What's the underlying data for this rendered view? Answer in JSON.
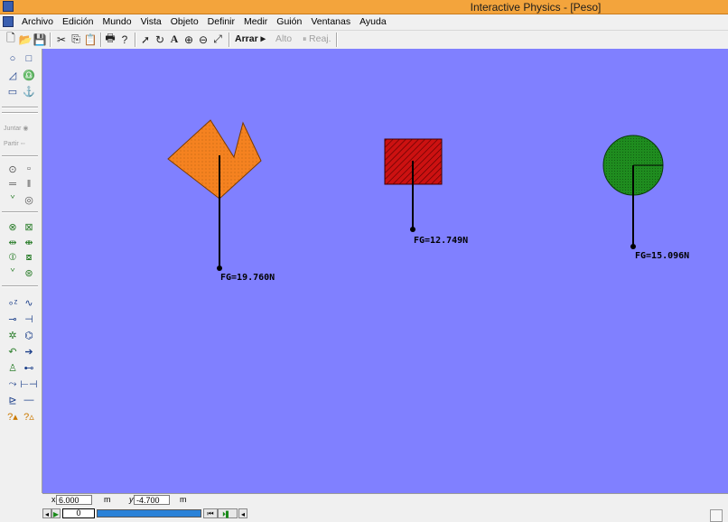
{
  "window": {
    "title": "Interactive Physics - [Peso]"
  },
  "menu": [
    "Archivo",
    "Edición",
    "Mundo",
    "Vista",
    "Objeto",
    "Definir",
    "Medir",
    "Guión",
    "Ventanas",
    "Ayuda"
  ],
  "toolbar": {
    "run_label": "Arrar",
    "stop_label": "Alto",
    "reset_label": "Reaj."
  },
  "palette": {
    "join_label": "Juntar",
    "split_label": "Partir"
  },
  "canvas": {
    "background": "#8080ff",
    "bodies": [
      {
        "shape": "polygon",
        "color": "#f58220",
        "force_label": "FG=19.760N"
      },
      {
        "shape": "rectangle",
        "color": "#cc1111",
        "force_label": "FG=12.749N"
      },
      {
        "shape": "circle",
        "color": "#1f8c1f",
        "force_label": "FG=15.096N"
      }
    ]
  },
  "coords": {
    "x_label": "x",
    "x_value": "6.000",
    "x_unit": "m",
    "y_label": "y",
    "y_value": "-4.700",
    "y_unit": "m"
  },
  "tape": {
    "frame": "0"
  }
}
